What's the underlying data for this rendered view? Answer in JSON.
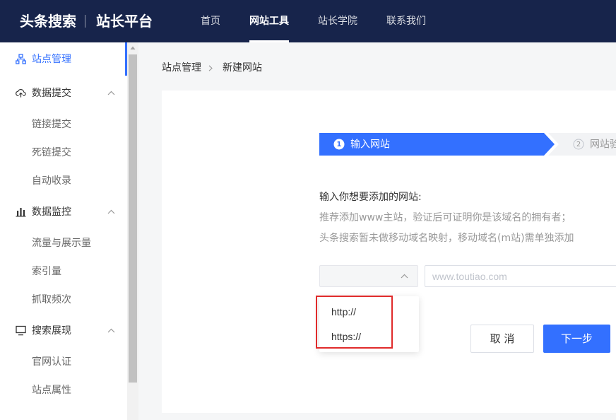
{
  "header": {
    "brand_main": "头条搜索",
    "brand_sub": "站长平台",
    "nav": [
      {
        "label": "首页"
      },
      {
        "label": "网站工具",
        "active": true
      },
      {
        "label": "站长学院"
      },
      {
        "label": "联系我们"
      }
    ]
  },
  "sidebar": {
    "items": [
      {
        "label": "站点管理",
        "icon": "sitemap-icon",
        "active": true
      },
      {
        "label": "数据提交",
        "icon": "cloud-upload-icon",
        "expanded": true,
        "children": [
          "链接提交",
          "死链提交",
          "自动收录"
        ]
      },
      {
        "label": "数据监控",
        "icon": "bar-chart-icon",
        "expanded": true,
        "children": [
          "流量与展示量",
          "索引量",
          "抓取频次"
        ]
      },
      {
        "label": "搜索展现",
        "icon": "monitor-icon",
        "expanded": true,
        "children": [
          "官网认证",
          "站点属性"
        ]
      }
    ]
  },
  "breadcrumb": {
    "items": [
      "站点管理",
      "新建网站"
    ]
  },
  "steps": [
    {
      "number": "1",
      "label": "输入网站",
      "active": true
    },
    {
      "number": "2",
      "label": "网站验"
    }
  ],
  "form": {
    "intro": "输入你想要添加的网站:",
    "hints": [
      "推荐添加www主站，验证后可证明你是该域名的拥有者；",
      "头条搜索暂未做移动域名映射，移动域名(m站)需单独添加"
    ],
    "protocol_select": {
      "value": "",
      "expanded": true,
      "options": [
        "http://",
        "https://"
      ]
    },
    "domain_input": {
      "value": "",
      "placeholder": "www.toutiao.com"
    },
    "cancel_label": "取 消",
    "next_label": "下一步"
  },
  "colors": {
    "header_bg": "#17244b",
    "accent": "#3370ff",
    "annotation": "#e02b2b"
  }
}
